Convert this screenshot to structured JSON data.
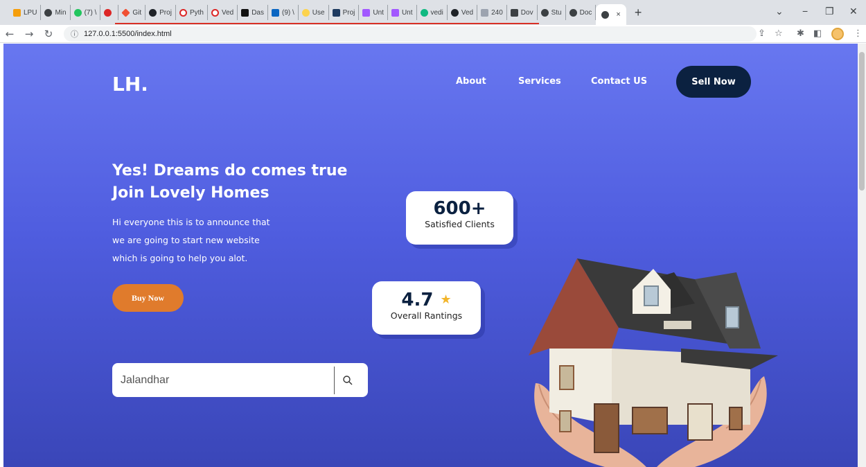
{
  "browser": {
    "tabs": [
      "LPU",
      "Min",
      "(7) \\",
      "",
      "Git",
      "Proj",
      "Pyth",
      "Ved",
      "Das",
      "(9) \\",
      "Use",
      "Proj",
      "Unt",
      "Unt",
      "vedi",
      "Ved",
      "240",
      "Dov",
      "Stu",
      "Doc"
    ],
    "active_tab_close": "×",
    "new_tab": "+",
    "url": "127.0.0.1:5500/index.html",
    "window": {
      "minimize": "−",
      "maximize": "❐",
      "close": "✕",
      "dropdown": "⌄"
    }
  },
  "site": {
    "logo": "LH.",
    "nav": {
      "about": "About",
      "services": "Services",
      "contact": "Contact US",
      "cta": "Sell Now"
    },
    "hero": {
      "headline_line1": "Yes! Dreams do comes true",
      "headline_line2": "Join Lovely Homes",
      "desc_line1": "Hi everyone this is to announce that",
      "desc_line2": "we are going to start new website",
      "desc_line3": "which is going to help you alot.",
      "button": "Buy Now"
    },
    "search": {
      "value": "Jalandhar"
    },
    "stats": [
      {
        "value": "600+",
        "label": "Satisfied Clients"
      },
      {
        "value": "4.7",
        "label": "Overall Rantings"
      }
    ]
  }
}
